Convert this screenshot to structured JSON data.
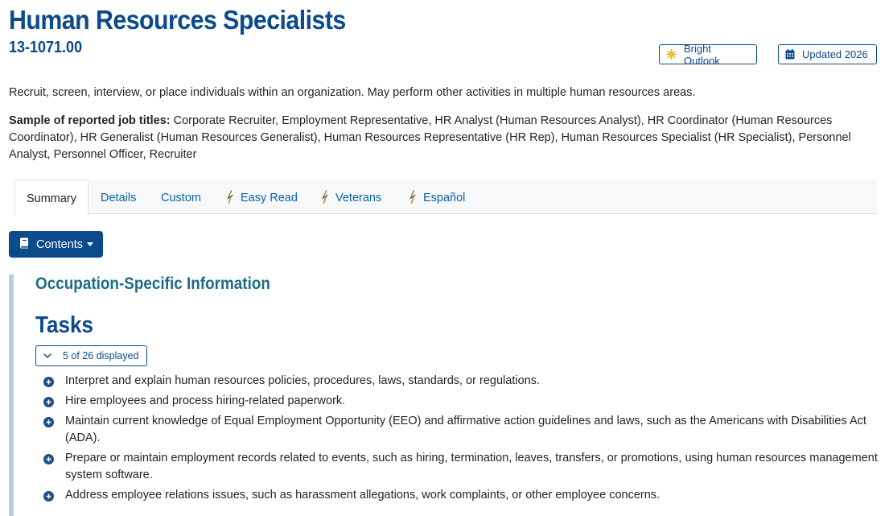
{
  "occupation": {
    "title": "Human Resources Specialists",
    "code": "13-1071.00"
  },
  "badges": {
    "bright_outlook": "Bright Outlook",
    "updated": "Updated 2026"
  },
  "description": "Recruit, screen, interview, or place individuals within an organization. May perform other activities in multiple human resources areas.",
  "sample_titles": {
    "label": "Sample of reported job titles:",
    "text": "Corporate Recruiter, Employment Representative, HR Analyst (Human Resources Analyst), HR Coordinator (Human Resources Coordinator), HR Generalist (Human Resources Generalist), Human Resources Representative (HR Rep), Human Resources Specialist (HR Specialist), Personnel Analyst, Personnel Officer, Recruiter"
  },
  "tabs": [
    {
      "label": "Summary"
    },
    {
      "label": "Details"
    },
    {
      "label": "Custom"
    },
    {
      "label": "Easy Read"
    },
    {
      "label": "Veterans"
    },
    {
      "label": "Español"
    }
  ],
  "contents_button": "Contents",
  "section": {
    "heading": "Occupation-Specific Information",
    "tasks_heading": "Tasks",
    "toggle_label": "5 of 26 displayed",
    "tasks": [
      "Interpret and explain human resources policies, procedures, laws, standards, or regulations.",
      "Hire employees and process hiring-related paperwork.",
      "Maintain current knowledge of Equal Employment Opportunity (EEO) and affirmative action guidelines and laws, such as the Americans with Disabilities Act (ADA).",
      "Prepare or maintain employment records related to events, such as hiring, termination, leaves, transfers, or promotions, using human resources management system software.",
      "Address employee relations issues, such as harassment allegations, work complaints, or other employee concerns."
    ]
  },
  "colors": {
    "brand_blue": "#0b4a8b",
    "link_blue": "#0b62a9",
    "section_teal": "#1b6d87",
    "sun_yellow": "#f5c400",
    "bullet_blue": "#1e4e86"
  }
}
